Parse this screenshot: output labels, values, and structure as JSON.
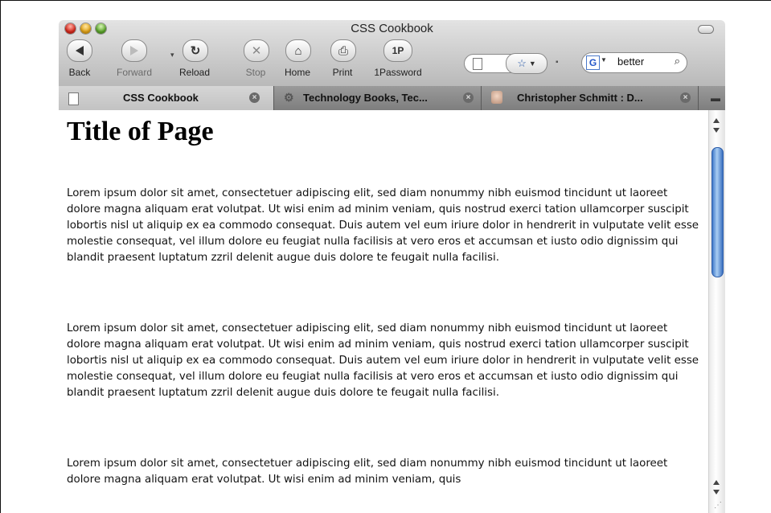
{
  "window": {
    "title": "CSS Cookbook"
  },
  "toolbar": {
    "back": "Back",
    "forward": "Forward",
    "reload": "Reload",
    "stop": "Stop",
    "home": "Home",
    "print": "Print",
    "onepassword": "1Password",
    "onepassword_icon": "1P"
  },
  "search": {
    "value": "better",
    "engine_icon": "G"
  },
  "tabs": [
    {
      "label": "CSS Cookbook",
      "active": true
    },
    {
      "label": "Technology Books, Tec...",
      "active": false
    },
    {
      "label": "Christopher Schmitt : D...",
      "active": false
    }
  ],
  "page": {
    "title": "Title of Page",
    "paragraphs": [
      "Lorem ipsum dolor sit amet, consectetuer adipiscing elit, sed diam nonummy nibh euismod tincidunt ut laoreet dolore magna aliquam erat volutpat. Ut wisi enim ad minim veniam, quis nostrud exerci tation ullamcorper suscipit lobortis nisl ut aliquip ex ea commodo consequat. Duis autem vel eum iriure dolor in hendrerit in vulputate velit esse molestie consequat, vel illum dolore eu feugiat nulla facilisis at vero eros et accumsan et iusto odio dignissim qui blandit praesent luptatum zzril delenit augue duis dolore te feugait nulla facilisi.",
      "Lorem ipsum dolor sit amet, consectetuer adipiscing elit, sed diam nonummy nibh euismod tincidunt ut laoreet dolore magna aliquam erat volutpat. Ut wisi enim ad minim veniam, quis nostrud exerci tation ullamcorper suscipit lobortis nisl ut aliquip ex ea commodo consequat. Duis autem vel eum iriure dolor in hendrerit in vulputate velit esse molestie consequat, vel illum dolore eu feugiat nulla facilisis at vero eros et accumsan et iusto odio dignissim qui blandit praesent luptatum zzril delenit augue duis dolore te feugait nulla facilisi.",
      "Lorem ipsum dolor sit amet, consectetuer adipiscing elit, sed diam nonummy nibh euismod tincidunt ut laoreet dolore magna aliquam erat volutpat. Ut wisi enim ad minim veniam, quis"
    ]
  },
  "colors": {
    "scroll_thumb": "#3f79c9",
    "close_red": "#d8281b",
    "minimize_yellow": "#e3a316",
    "zoom_green": "#5ba62a"
  }
}
